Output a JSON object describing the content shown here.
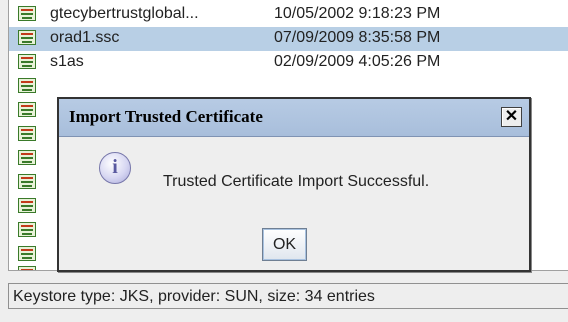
{
  "certificates": [
    {
      "alias": "gtecybertrustglobal...",
      "date": "10/05/2002 9:18:23 PM",
      "selected": false
    },
    {
      "alias": "orad1.ssc",
      "date": "07/09/2009 8:35:58 PM",
      "selected": true
    },
    {
      "alias": "s1as",
      "date": "02/09/2009 4:05:26 PM",
      "selected": false
    }
  ],
  "status_bar": {
    "text": "Keystore type: JKS, provider: SUN, size: 34 entries"
  },
  "dialog": {
    "title": "Import Trusted Certificate",
    "close_glyph": "✕",
    "icon": "information-icon",
    "icon_glyph": "i",
    "message": "Trusted Certificate Import Successful.",
    "ok_label": "OK"
  },
  "colors": {
    "selection": "#b8cfe5",
    "titlebar": "#b7cbe4",
    "cert_icon_green": "#3a7a2a"
  }
}
